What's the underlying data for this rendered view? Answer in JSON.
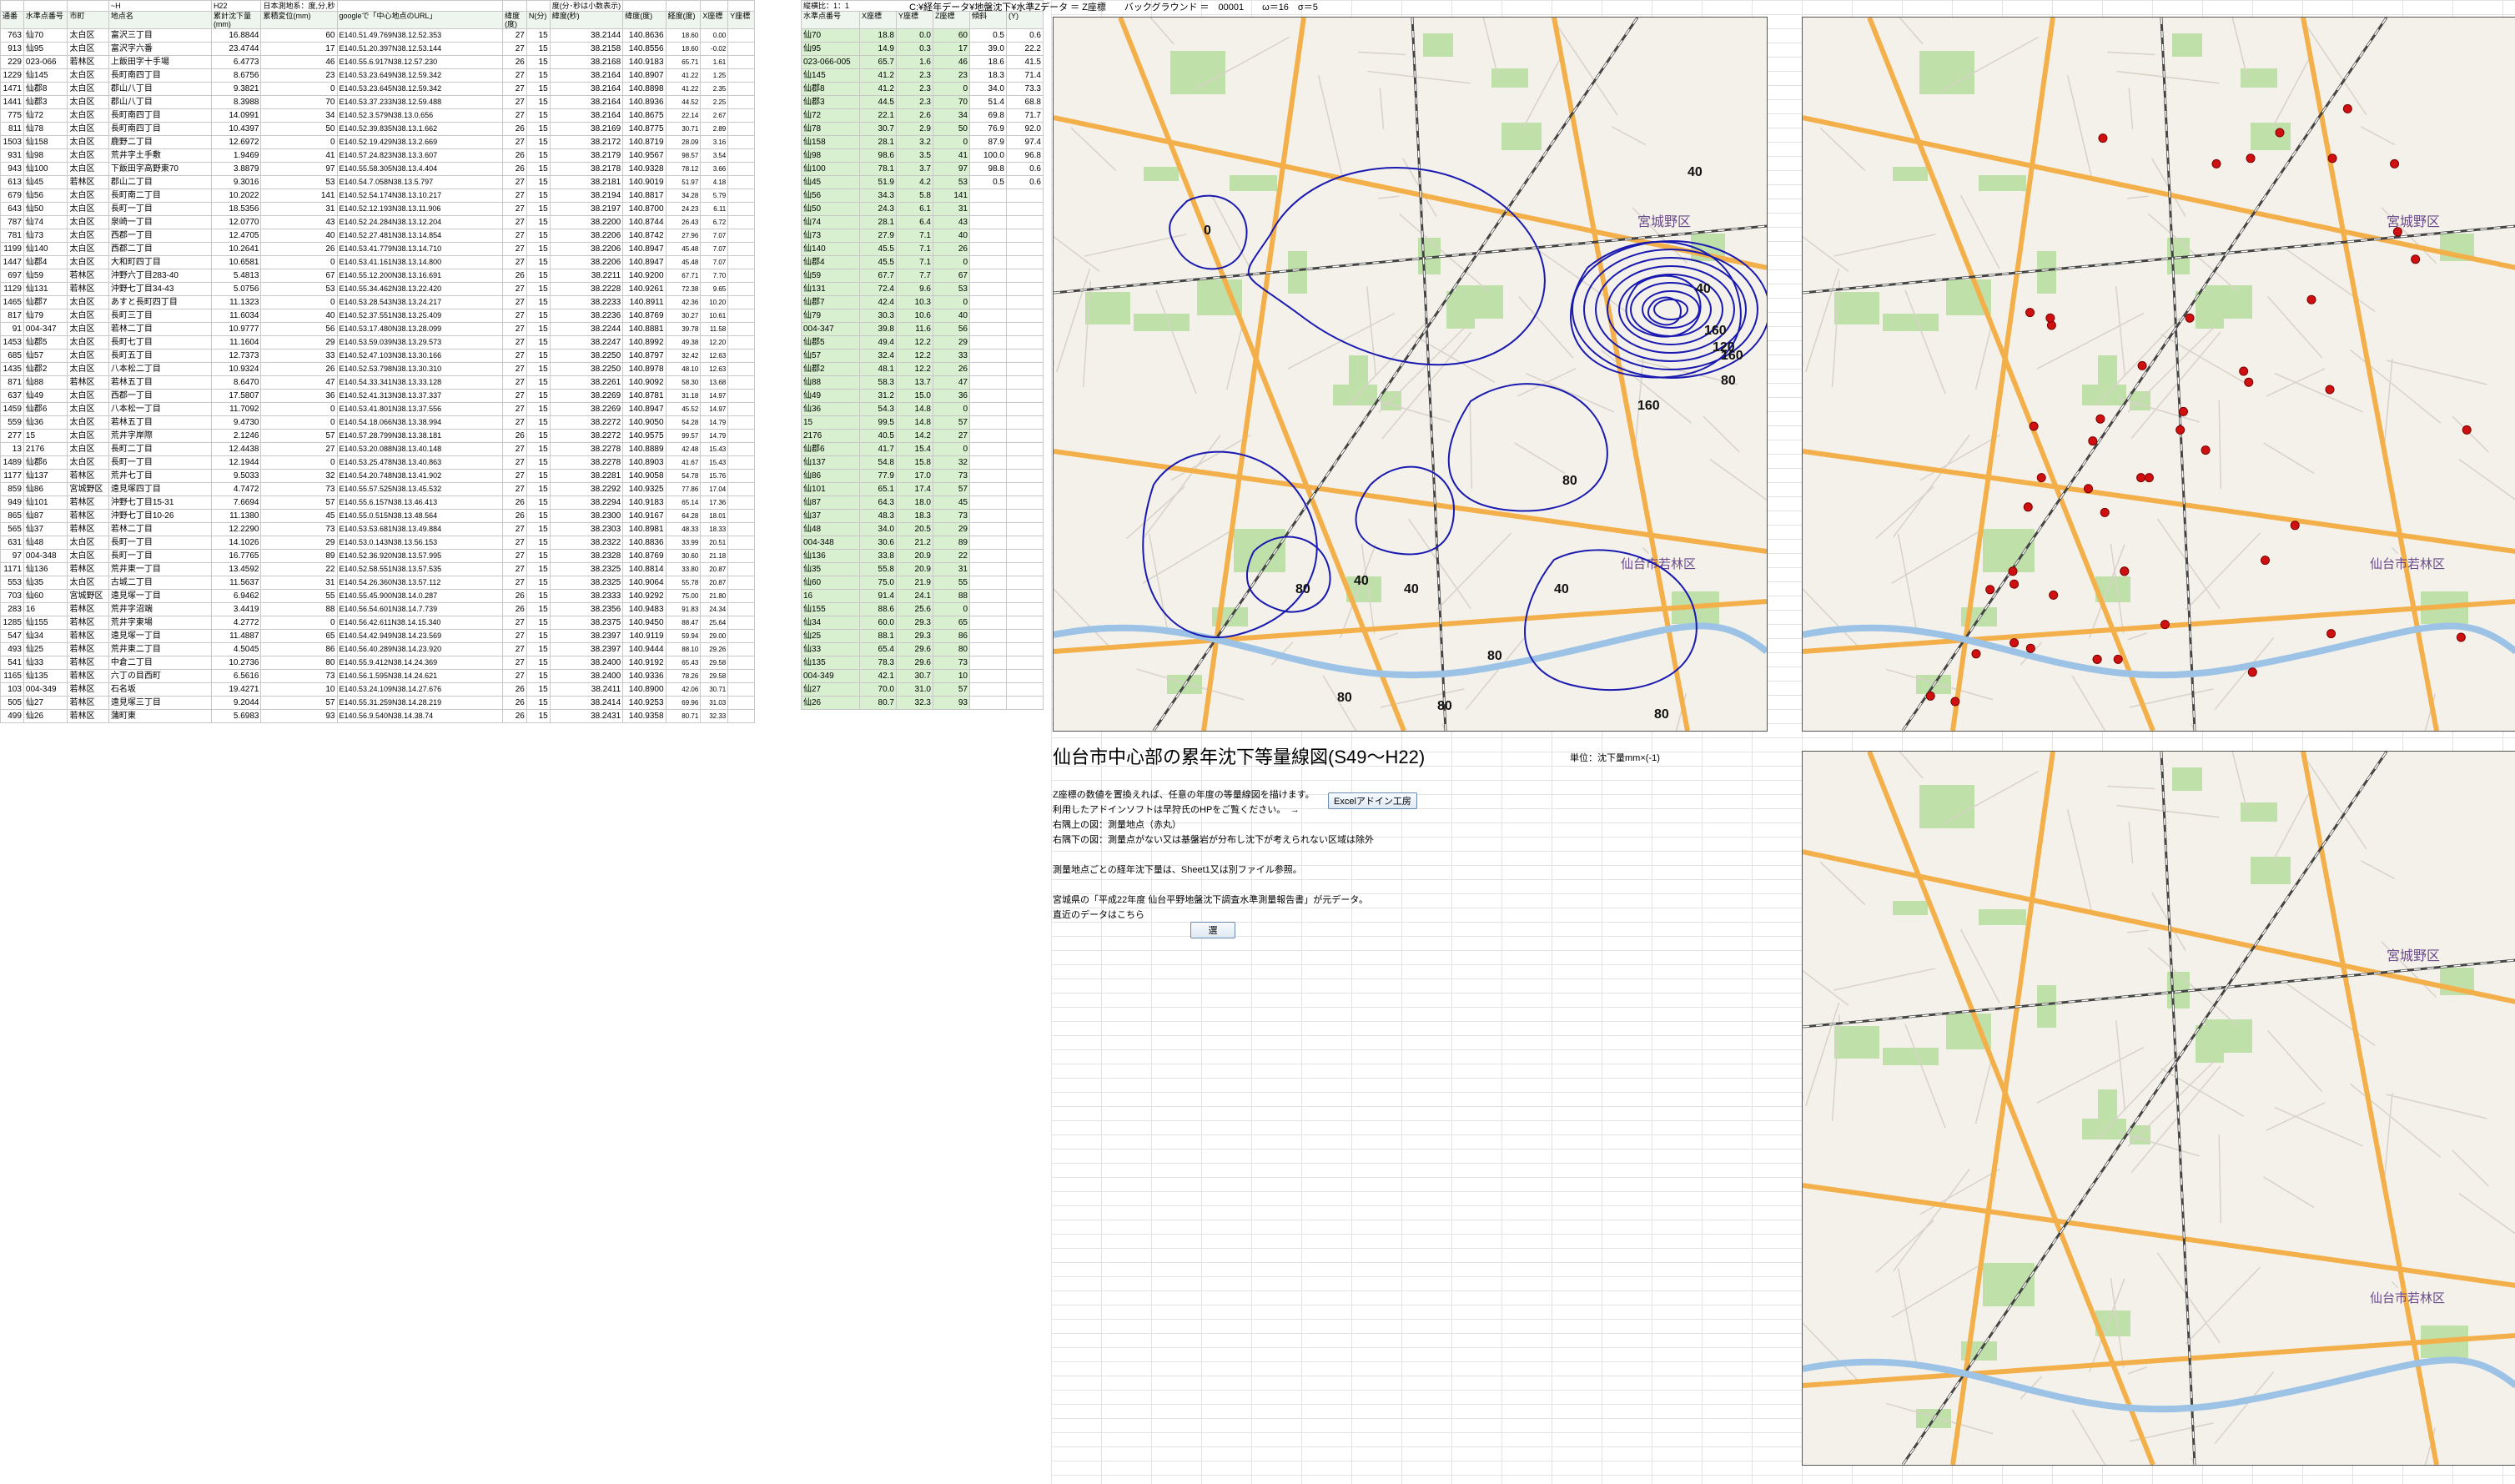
{
  "sheet": {
    "header_path": "C:¥経年データ¥地盤沈下¥水準Zデータ ＝ Z座標　　バックグラウンド ＝　00001　　ω＝16　σ＝5",
    "header_scale": "縦横比：1：1"
  },
  "left_table": {
    "top_labels": [
      "",
      "",
      "",
      "~H",
      "H22",
      "日本測地系：度,分,秒",
      "",
      "",
      "",
      "度(分･秒は小数表示)",
      "",
      "",
      "",
      ""
    ],
    "headers": [
      "通番",
      "水準点番号",
      "市町",
      "地点名",
      "累計沈下量(mm)",
      "累積変位(mm)",
      "googleで「中心地点のURL」",
      "緯度(度)",
      "N(分)",
      "緯度(秒)",
      "緯度(度)",
      "経度(度)",
      "X座標",
      "Y座標"
    ],
    "rows": [
      [
        "763",
        "仙70",
        "太白区",
        "富沢三丁目",
        "16.8844",
        "60",
        "E140.51.49.769N38.12.52.353",
        "27",
        "15",
        "38.2144",
        "140.8636",
        "18.60",
        "0.00"
      ],
      [
        "913",
        "仙95",
        "太白区",
        "富沢字六番",
        "23.4744",
        "17",
        "E140.51.20.397N38.12.53.144",
        "27",
        "15",
        "38.2158",
        "140.8556",
        "18.60",
        "-0.02"
      ],
      [
        "229",
        "023-066",
        "若林区",
        "上飯田字十手場",
        "6.4773",
        "46",
        "E140.55.6.917N38.12.57.230",
        "26",
        "15",
        "38.2168",
        "140.9183",
        "65.71",
        "1.61"
      ],
      [
        "1229",
        "仙145",
        "太白区",
        "長町南四丁目",
        "8.6756",
        "23",
        "E140.53.23.649N38.12.59.342",
        "27",
        "15",
        "38.2164",
        "140.8907",
        "41.22",
        "1.25"
      ],
      [
        "1471",
        "仙郡8",
        "太白区",
        "郡山八丁目",
        "9.3821",
        "0",
        "E140.53.23.645N38.12.59.342",
        "27",
        "15",
        "38.2164",
        "140.8898",
        "41.22",
        "2.35"
      ],
      [
        "1441",
        "仙郡3",
        "太白区",
        "郡山八丁目",
        "8.3988",
        "70",
        "E140.53.37.233N38.12.59.488",
        "27",
        "15",
        "38.2164",
        "140.8936",
        "44.52",
        "2.25"
      ],
      [
        "775",
        "仙72",
        "太白区",
        "長町南四丁目",
        "14.0991",
        "34",
        "E140.52.3.579N38.13.0.656",
        "27",
        "15",
        "38.2164",
        "140.8675",
        "22.14",
        "2.67"
      ],
      [
        "811",
        "仙78",
        "太白区",
        "長町南四丁目",
        "10.4397",
        "50",
        "E140.52.39.835N38.13.1.662",
        "26",
        "15",
        "38.2169",
        "140.8775",
        "30.71",
        "2.89"
      ],
      [
        "1503",
        "仙158",
        "太白区",
        "鹿野二丁目",
        "12.6972",
        "0",
        "E140.52.19.429N38.13.2.669",
        "27",
        "15",
        "38.2172",
        "140.8719",
        "28.09",
        "3.16"
      ],
      [
        "931",
        "仙98",
        "太白区",
        "荒井字土手敷",
        "1.9469",
        "41",
        "E140.57.24.823N38.13.3.607",
        "26",
        "15",
        "38.2179",
        "140.9567",
        "98.57",
        "3.54"
      ],
      [
        "943",
        "仙100",
        "太白区",
        "下飯田字高野東70",
        "3.8879",
        "97",
        "E140.55.58.305N38.13.4.404",
        "26",
        "15",
        "38.2178",
        "140.9328",
        "78.12",
        "3.66"
      ],
      [
        "613",
        "仙45",
        "若林区",
        "郡山二丁目",
        "9.3016",
        "53",
        "E140.54.7.058N38.13.5.797",
        "27",
        "15",
        "38.2181",
        "140.9019",
        "51.97",
        "4.18"
      ],
      [
        "679",
        "仙56",
        "太白区",
        "長町南二丁目",
        "10.2022",
        "141",
        "E140.52.54.174N38.13.10.217",
        "27",
        "15",
        "38.2194",
        "140.8817",
        "34.28",
        "5.79"
      ],
      [
        "643",
        "仙50",
        "太白区",
        "長町一丁目",
        "18.5356",
        "31",
        "E140.52.12.193N38.13.11.906",
        "27",
        "15",
        "38.2197",
        "140.8700",
        "24.23",
        "6.11"
      ],
      [
        "787",
        "仙74",
        "太白区",
        "泉崎一丁目",
        "12.0770",
        "43",
        "E140.52.24.284N38.13.12.204",
        "27",
        "15",
        "38.2200",
        "140.8744",
        "26.43",
        "6.72"
      ],
      [
        "781",
        "仙73",
        "太白区",
        "西郡一丁目",
        "12.4705",
        "40",
        "E140.52.27.481N38.13.14.854",
        "27",
        "15",
        "38.2206",
        "140.8742",
        "27.96",
        "7.07"
      ],
      [
        "1199",
        "仙140",
        "太白区",
        "西郡二丁目",
        "10.2641",
        "26",
        "E140.53.41.779N38.13.14.710",
        "27",
        "15",
        "38.2206",
        "140.8947",
        "45.48",
        "7.07"
      ],
      [
        "1447",
        "仙郡4",
        "太白区",
        "大和町四丁目",
        "10.6581",
        "0",
        "E140.53.41.161N38.13.14.800",
        "27",
        "15",
        "38.2206",
        "140.8947",
        "45.48",
        "7.07"
      ],
      [
        "697",
        "仙59",
        "若林区",
        "沖野六丁目283-40",
        "5.4813",
        "67",
        "E140.55.12.200N38.13.16.691",
        "26",
        "15",
        "38.2211",
        "140.9200",
        "67.71",
        "7.70"
      ],
      [
        "1129",
        "仙131",
        "若林区",
        "沖野七丁目34-43",
        "5.0756",
        "53",
        "E140.55.34.462N38.13.22.420",
        "27",
        "15",
        "38.2228",
        "140.9261",
        "72.38",
        "9.65"
      ],
      [
        "1465",
        "仙郡7",
        "太白区",
        "あすと長町四丁目",
        "11.1323",
        "0",
        "E140.53.28.543N38.13.24.217",
        "27",
        "15",
        "38.2233",
        "140.8911",
        "42.36",
        "10.20"
      ],
      [
        "817",
        "仙79",
        "太白区",
        "長町三丁目",
        "11.6034",
        "40",
        "E140.52.37.551N38.13.25.409",
        "27",
        "15",
        "38.2236",
        "140.8769",
        "30.27",
        "10.61"
      ],
      [
        "91",
        "004-347",
        "太白区",
        "若林二丁目",
        "10.9777",
        "56",
        "E140.53.17.480N38.13.28.099",
        "27",
        "15",
        "38.2244",
        "140.8881",
        "39.78",
        "11.58"
      ],
      [
        "1453",
        "仙郡5",
        "太白区",
        "長町七丁目",
        "11.1604",
        "29",
        "E140.53.59.039N38.13.29.573",
        "27",
        "15",
        "38.2247",
        "140.8992",
        "49.38",
        "12.20"
      ],
      [
        "685",
        "仙57",
        "太白区",
        "長町五丁目",
        "12.7373",
        "33",
        "E140.52.47.103N38.13.30.166",
        "27",
        "15",
        "38.2250",
        "140.8797",
        "32.42",
        "12.63"
      ],
      [
        "1435",
        "仙郡2",
        "太白区",
        "八本松二丁目",
        "10.9324",
        "26",
        "E140.52.53.798N38.13.30.310",
        "27",
        "15",
        "38.2250",
        "140.8978",
        "48.10",
        "12.63"
      ],
      [
        "871",
        "仙88",
        "若林区",
        "若林五丁目",
        "8.6470",
        "47",
        "E140.54.33.341N38.13.33.128",
        "27",
        "15",
        "38.2261",
        "140.9092",
        "58.30",
        "13.68"
      ],
      [
        "637",
        "仙49",
        "太白区",
        "西郡一丁目",
        "17.5807",
        "36",
        "E140.52.41.313N38.13.37.337",
        "27",
        "15",
        "38.2269",
        "140.8781",
        "31.18",
        "14.97"
      ],
      [
        "1459",
        "仙郡6",
        "太白区",
        "八本松一丁目",
        "11.7092",
        "0",
        "E140.53.41.801N38.13.37.556",
        "27",
        "15",
        "38.2269",
        "140.8947",
        "45.52",
        "14.97"
      ],
      [
        "559",
        "仙36",
        "太白区",
        "若林五丁目",
        "9.4730",
        "0",
        "E140.54.18.066N38.13.38.994",
        "27",
        "15",
        "38.2272",
        "140.9050",
        "54.28",
        "14.79"
      ],
      [
        "277",
        "15",
        "太白区",
        "荒井字岸際",
        "2.1246",
        "57",
        "E140.57.28.799N38.13.38.181",
        "26",
        "15",
        "38.2272",
        "140.9575",
        "99.57",
        "14.79"
      ],
      [
        "13",
        "2176",
        "太白区",
        "長町二丁目",
        "12.4438",
        "27",
        "E140.53.20.088N38.13.40.148",
        "27",
        "15",
        "38.2278",
        "140.8889",
        "42.48",
        "15.43"
      ],
      [
        "1489",
        "仙郡6",
        "太白区",
        "長町一丁目",
        "12.1944",
        "0",
        "E140.53.25.478N38.13.40.863",
        "27",
        "15",
        "38.2278",
        "140.8903",
        "41.67",
        "15.43"
      ],
      [
        "1177",
        "仙137",
        "若林区",
        "荒井七丁目",
        "9.5033",
        "32",
        "E140.54.20.748N38.13.41.902",
        "27",
        "15",
        "38.2281",
        "140.9058",
        "54.78",
        "15.76"
      ],
      [
        "859",
        "仙86",
        "宮城野区",
        "遠見塚四丁目",
        "4.7472",
        "73",
        "E140.55.57.525N38.13.45.532",
        "27",
        "15",
        "38.2292",
        "140.9325",
        "77.86",
        "17.04"
      ],
      [
        "949",
        "仙101",
        "若林区",
        "沖野七丁目15-31",
        "7.6694",
        "57",
        "E140.55.6.157N38.13.46.413",
        "26",
        "15",
        "38.2294",
        "140.9183",
        "65.14",
        "17.36"
      ],
      [
        "865",
        "仙87",
        "若林区",
        "沖野七丁目10-26",
        "11.1380",
        "45",
        "E140.55.0.515N38.13.48.564",
        "26",
        "15",
        "38.2300",
        "140.9167",
        "64.28",
        "18.01"
      ],
      [
        "565",
        "仙37",
        "若林区",
        "若林二丁目",
        "12.2290",
        "73",
        "E140.53.53.681N38.13.49.884",
        "27",
        "15",
        "38.2303",
        "140.8981",
        "48.33",
        "18.33"
      ],
      [
        "631",
        "仙48",
        "太白区",
        "長町一丁目",
        "14.1026",
        "29",
        "E140.53.0.143N38.13.56.153",
        "27",
        "15",
        "38.2322",
        "140.8836",
        "33.99",
        "20.51"
      ],
      [
        "97",
        "004-348",
        "太白区",
        "長町一丁目",
        "16.7765",
        "89",
        "E140.52.36.920N38.13.57.995",
        "27",
        "15",
        "38.2328",
        "140.8769",
        "30.60",
        "21.18"
      ],
      [
        "1171",
        "仙136",
        "若林区",
        "荒井東一丁目",
        "13.4592",
        "22",
        "E140.52.58.551N38.13.57.535",
        "27",
        "15",
        "38.2325",
        "140.8814",
        "33.80",
        "20.87"
      ],
      [
        "553",
        "仙35",
        "太白区",
        "古城二丁目",
        "11.5637",
        "31",
        "E140.54.26.360N38.13.57.112",
        "27",
        "15",
        "38.2325",
        "140.9064",
        "55.78",
        "20.87"
      ],
      [
        "703",
        "仙60",
        "宮城野区",
        "遠見塚一丁目",
        "6.9462",
        "55",
        "E140.55.45.900N38.14.0.287",
        "26",
        "15",
        "38.2333",
        "140.9292",
        "75.00",
        "21.80"
      ],
      [
        "283",
        "16",
        "若林区",
        "荒井字沼端",
        "3.4419",
        "88",
        "E140.56.54.601N38.14.7.739",
        "26",
        "15",
        "38.2356",
        "140.9483",
        "91.83",
        "24.34"
      ],
      [
        "1285",
        "仙155",
        "若林区",
        "荒井字東場",
        "4.2772",
        "0",
        "E140.56.42.611N38.14.15.340",
        "27",
        "15",
        "38.2375",
        "140.9450",
        "88.47",
        "25.64"
      ],
      [
        "547",
        "仙34",
        "若林区",
        "遠見塚一丁目",
        "11.4887",
        "65",
        "E140.54.42.949N38.14.23.569",
        "27",
        "15",
        "38.2397",
        "140.9119",
        "59.94",
        "29.00"
      ],
      [
        "493",
        "仙25",
        "若林区",
        "荒井東二丁目",
        "4.5045",
        "86",
        "E140.56.40.289N38.14.23.920",
        "27",
        "15",
        "38.2397",
        "140.9444",
        "88.10",
        "29.26"
      ],
      [
        "541",
        "仙33",
        "若林区",
        "中倉二丁目",
        "10.2736",
        "80",
        "E140.55.9.412N38.14.24.369",
        "27",
        "15",
        "38.2400",
        "140.9192",
        "65.43",
        "29.58"
      ],
      [
        "1165",
        "仙135",
        "若林区",
        "六丁の目西町",
        "6.5616",
        "73",
        "E140.56.1.595N38.14.24.621",
        "27",
        "15",
        "38.2400",
        "140.9336",
        "78.26",
        "29.58"
      ],
      [
        "103",
        "004-349",
        "若林区",
        "石名坂",
        "19.4271",
        "10",
        "E140.53.24.109N38.14.27.676",
        "26",
        "15",
        "38.2411",
        "140.8900",
        "42.06",
        "30.71"
      ],
      [
        "505",
        "仙27",
        "若林区",
        "遠見塚三丁目",
        "9.2044",
        "57",
        "E140.55.31.259N38.14.28.219",
        "26",
        "15",
        "38.2414",
        "140.9253",
        "69.96",
        "31.03"
      ],
      [
        "499",
        "仙26",
        "若林区",
        "蒲町東",
        "5.6983",
        "93",
        "E140.56.9.540N38.14.38.74",
        "26",
        "15",
        "38.2431",
        "140.9358",
        "80.71",
        "32.33"
      ]
    ]
  },
  "mid_table": {
    "top_label": "縦横比：1：1",
    "headers": [
      "水準点番号",
      "X座標",
      "Y座標",
      "Z座標",
      "傾斜",
      "(Y)"
    ],
    "rows": [
      [
        "仙70",
        "18.8",
        "0.0",
        "60",
        "0.5",
        "0.6"
      ],
      [
        "仙95",
        "14.9",
        "0.3",
        "17",
        "39.0",
        "22.2"
      ],
      [
        "023-066-005",
        "65.7",
        "1.6",
        "46",
        "18.6",
        "41.5"
      ],
      [
        "仙145",
        "41.2",
        "2.3",
        "23",
        "18.3",
        "71.4"
      ],
      [
        "仙郡8",
        "41.2",
        "2.3",
        "0",
        "34.0",
        "73.3"
      ],
      [
        "仙郡3",
        "44.5",
        "2.3",
        "70",
        "51.4",
        "68.8"
      ],
      [
        "仙72",
        "22.1",
        "2.6",
        "34",
        "69.8",
        "71.7"
      ],
      [
        "仙78",
        "30.7",
        "2.9",
        "50",
        "76.9",
        "92.0"
      ],
      [
        "仙158",
        "28.1",
        "3.2",
        "0",
        "87.9",
        "97.4"
      ],
      [
        "仙98",
        "98.6",
        "3.5",
        "41",
        "100.0",
        "96.8"
      ],
      [
        "仙100",
        "78.1",
        "3.7",
        "97",
        "98.8",
        "0.6"
      ],
      [
        "仙45",
        "51.9",
        "4.2",
        "53",
        "0.5",
        "0.6"
      ],
      [
        "仙56",
        "34.3",
        "5.8",
        "141",
        "",
        ""
      ],
      [
        "仙50",
        "24.3",
        "6.1",
        "31",
        "",
        ""
      ],
      [
        "仙74",
        "28.1",
        "6.4",
        "43",
        "",
        ""
      ],
      [
        "仙73",
        "27.9",
        "7.1",
        "40",
        "",
        ""
      ],
      [
        "仙140",
        "45.5",
        "7.1",
        "26",
        "",
        ""
      ],
      [
        "仙郡4",
        "45.5",
        "7.1",
        "0",
        "",
        ""
      ],
      [
        "仙59",
        "67.7",
        "7.7",
        "67",
        "",
        ""
      ],
      [
        "仙131",
        "72.4",
        "9.6",
        "53",
        "",
        ""
      ],
      [
        "仙郡7",
        "42.4",
        "10.3",
        "0",
        "",
        ""
      ],
      [
        "仙79",
        "30.3",
        "10.6",
        "40",
        "",
        ""
      ],
      [
        "004-347",
        "39.8",
        "11.6",
        "56",
        "",
        ""
      ],
      [
        "仙郡5",
        "49.4",
        "12.2",
        "29",
        "",
        ""
      ],
      [
        "仙57",
        "32.4",
        "12.2",
        "33",
        "",
        ""
      ],
      [
        "仙郡2",
        "48.1",
        "12.2",
        "26",
        "",
        ""
      ],
      [
        "仙88",
        "58.3",
        "13.7",
        "47",
        "",
        ""
      ],
      [
        "仙49",
        "31.2",
        "15.0",
        "36",
        "",
        ""
      ],
      [
        "仙36",
        "54.3",
        "14.8",
        "0",
        "",
        ""
      ],
      [
        "15",
        "99.5",
        "14.8",
        "57",
        "",
        ""
      ],
      [
        "2176",
        "40.5",
        "14.2",
        "27",
        "",
        ""
      ],
      [
        "仙郡6",
        "41.7",
        "15.4",
        "0",
        "",
        ""
      ],
      [
        "仙137",
        "54.8",
        "15.8",
        "32",
        "",
        ""
      ],
      [
        "仙86",
        "77.9",
        "17.0",
        "73",
        "",
        ""
      ],
      [
        "仙101",
        "65.1",
        "17.4",
        "57",
        "",
        ""
      ],
      [
        "仙87",
        "64.3",
        "18.0",
        "45",
        "",
        ""
      ],
      [
        "仙37",
        "48.3",
        "18.3",
        "73",
        "",
        ""
      ],
      [
        "仙48",
        "34.0",
        "20.5",
        "29",
        "",
        ""
      ],
      [
        "004-348",
        "30.6",
        "21.2",
        "89",
        "",
        ""
      ],
      [
        "仙136",
        "33.8",
        "20.9",
        "22",
        "",
        ""
      ],
      [
        "仙35",
        "55.8",
        "20.9",
        "31",
        "",
        ""
      ],
      [
        "仙60",
        "75.0",
        "21.9",
        "55",
        "",
        ""
      ],
      [
        "16",
        "91.4",
        "24.1",
        "88",
        "",
        ""
      ],
      [
        "仙155",
        "88.6",
        "25.6",
        "0",
        "",
        ""
      ],
      [
        "仙34",
        "60.0",
        "29.3",
        "65",
        "",
        ""
      ],
      [
        "仙25",
        "88.1",
        "29.3",
        "86",
        "",
        ""
      ],
      [
        "仙33",
        "65.4",
        "29.6",
        "80",
        "",
        ""
      ],
      [
        "仙135",
        "78.3",
        "29.6",
        "73",
        "",
        ""
      ],
      [
        "004-349",
        "42.1",
        "30.7",
        "10",
        "",
        ""
      ],
      [
        "仙27",
        "70.0",
        "31.0",
        "57",
        "",
        ""
      ],
      [
        "仙26",
        "80.7",
        "32.3",
        "93",
        "",
        ""
      ]
    ]
  },
  "description": {
    "title": "仙台市中心部の累年沈下等量線図(S49～H22)",
    "unit": "単位：沈下量mm×(-1)",
    "lines": [
      "Z座標の数値を置換えれば、任意の年度の等量線図を描けます。",
      "利用したアドインソフトは早狩氏のHPをご覧ください。　→",
      "右隅上の図：測量地点（赤丸）",
      "右隅下の図：測量点がない又は基盤岩が分布し沈下が考えられない区域は除外",
      "",
      "測量地点ごとの経年沈下量は、Sheet1又は別ファイル参照。",
      "",
      "宮城県の「平成22年度 仙台平野地盤沈下調査水準測量報告書」が元データ。",
      "直近のデータはこちら"
    ],
    "addin_button": "Excelアドイン工房",
    "back_button": "選"
  },
  "map": {
    "labels": [
      "宮城野区",
      "仙台市若林区"
    ],
    "contour_labels": [
      "0",
      "40",
      "40",
      "80",
      "120",
      "160",
      "160",
      "80",
      "40",
      "80",
      "40",
      "80",
      "80",
      "80",
      "80",
      "160",
      "40"
    ],
    "colors": {
      "contour": "#1a1ab0",
      "marker": "#d01010",
      "road": "#f3b04a",
      "green": "#bfe0a8",
      "rail": "#444444"
    }
  }
}
